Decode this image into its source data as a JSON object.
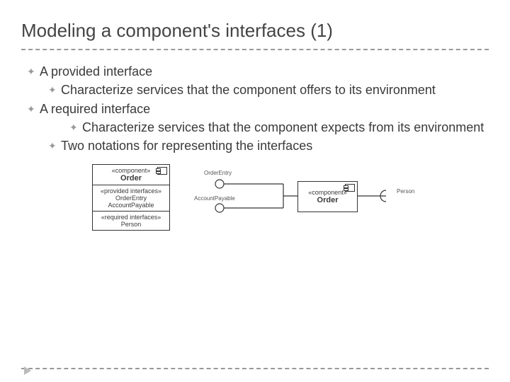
{
  "title": "Modeling a component's interfaces (1)",
  "bullets": {
    "b1": "A provided interface",
    "b1a": "Characterize services that the component offers to its environment",
    "b2": "A required interface",
    "b2a": "Characterize services that the component expects from its environment",
    "b3": "Two notations for representing the interfaces"
  },
  "diagram1": {
    "stereo": "«component»",
    "name": "Order",
    "provHdr": "«provided interfaces»",
    "prov1": "OrderEntry",
    "prov2": "AccountPayable",
    "reqHdr": "«required interfaces»",
    "req1": "Person"
  },
  "diagram2": {
    "if1": "OrderEntry",
    "if2": "AccountPayable",
    "compStereo": "«component»",
    "compName": "Order",
    "if3": "Person"
  }
}
